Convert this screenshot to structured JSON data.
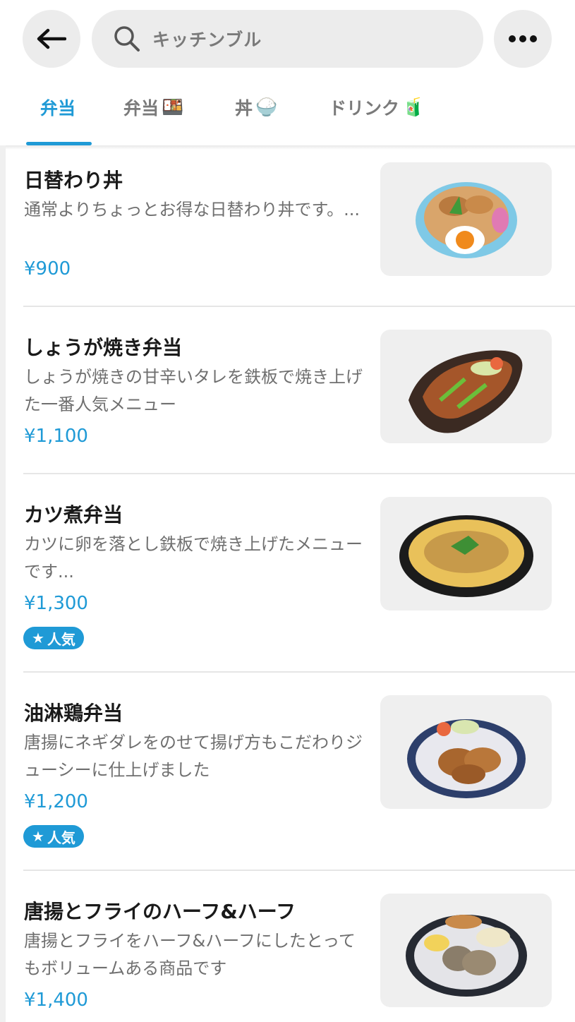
{
  "header": {
    "back_icon": "arrow-left-icon",
    "search_placeholder": "キッチンブル",
    "more_icon": "ellipsis-icon"
  },
  "tabs": [
    {
      "label": "弁当",
      "emoji": "",
      "active": true
    },
    {
      "label": "弁当",
      "emoji": "🍱",
      "active": false
    },
    {
      "label": "丼",
      "emoji": "🍚",
      "active": false
    },
    {
      "label": "ドリンク",
      "emoji": "🧃",
      "active": false
    }
  ],
  "items": [
    {
      "title": "日替わり丼",
      "desc": "通常よりちょっとお得な日替わり丼です。...",
      "price": "¥900",
      "badge": ""
    },
    {
      "title": "しょうが焼き弁当",
      "desc": "しょうが焼きの甘辛いタレを鉄板で焼き上げた一番人気メニュー",
      "price": "¥1,100",
      "badge": ""
    },
    {
      "title": "カツ煮弁当",
      "desc": "カツに卵を落とし鉄板で焼き上げたメニューです...",
      "price": "¥1,300",
      "badge": "人気"
    },
    {
      "title": "油淋鶏弁当",
      "desc": "唐揚にネギダレをのせて揚げ方もこだわりジューシーに仕上げました",
      "price": "¥1,200",
      "badge": "人気"
    },
    {
      "title": "唐揚とフライのハーフ&ハーフ",
      "desc": "唐揚とフライをハーフ&ハーフにしたとってもボリュームある商品です",
      "price": "¥1,400",
      "badge": ""
    }
  ],
  "colors": {
    "accent": "#1f9ad6",
    "text": "#1a1a1a",
    "muted": "#6f6f6f"
  }
}
